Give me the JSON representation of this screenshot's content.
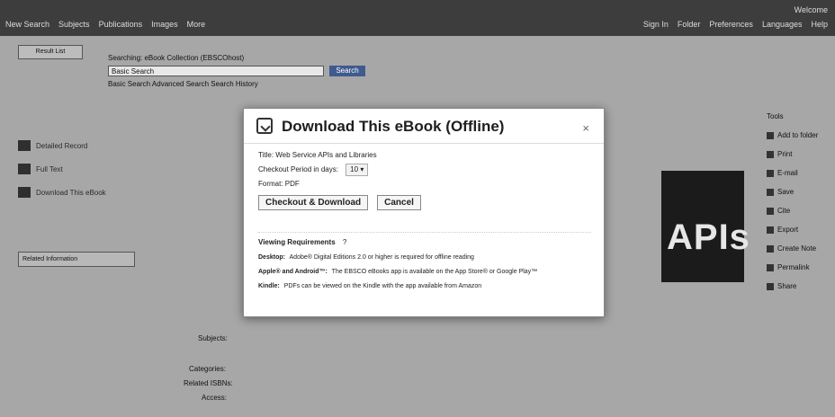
{
  "modal": {
    "title": "Download This eBook (Offline)",
    "close_label": "×",
    "title_label": "Title: Web Service APIs and Libraries",
    "checkout_label": "Checkout Period in days:",
    "checkout_value": "10",
    "format_label": "Format: PDF",
    "checkout_button": "Checkout & Download",
    "cancel_button": "Cancel",
    "requirements_header": "Viewing Requirements",
    "requirements_help": "?",
    "requirements": [
      {
        "platform": "Desktop:",
        "text": "Adobe® Digital Editions 2.0 or higher is required for offline reading"
      },
      {
        "platform": "Apple® and Android™:",
        "text": "The EBSCO eBooks app is available on the App Store® or Google Play™"
      },
      {
        "platform": "Kindle:",
        "text": "PDFs can be viewed on the Kindle with the app available from Amazon"
      }
    ]
  },
  "topbar": {
    "nav": [
      "New Search",
      "Subjects",
      "Publications",
      "Images",
      "More"
    ],
    "right": [
      "Sign In",
      "Folder",
      "Preferences",
      "Languages",
      "Help"
    ],
    "user": "Welcome"
  },
  "page": {
    "search_label": "Searching: eBook Collection (EBSCOhost)",
    "search_select": "Basic Search",
    "search_button": "Search",
    "search_links": "Basic Search  Advanced Search  Search History",
    "left_badge": "Result List",
    "left_actions": [
      "Detailed Record",
      "Full Text",
      "Download This eBook"
    ],
    "left_box_title": "Related Information",
    "right_tools": [
      "Tools",
      "Add to folder",
      "Print",
      "E-mail",
      "Save",
      "Cite",
      "Export",
      "Create Note",
      "Permalink",
      "Share"
    ],
    "cover_text": "APIs",
    "detail_rows": [
      "Subjects:",
      "Categories:",
      "Related ISBNs:",
      "Access:"
    ]
  }
}
